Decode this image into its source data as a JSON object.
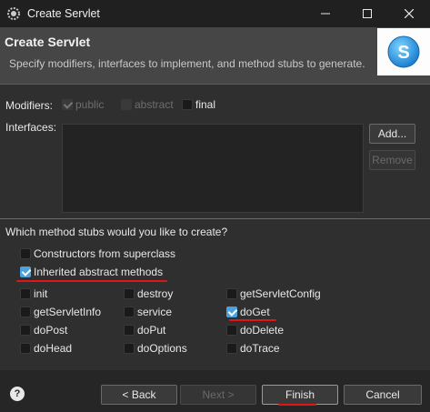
{
  "window": {
    "title": "Create Servlet",
    "minimize_icon": "minimize-icon",
    "maximize_icon": "maximize-icon",
    "close_icon": "close-icon"
  },
  "header": {
    "title": "Create Servlet",
    "description": "Specify modifiers, interfaces to implement, and method stubs to generate.",
    "logo_letter": "S"
  },
  "modifiers": {
    "label": "Modifiers:",
    "options": [
      {
        "label": "public",
        "checked": true,
        "enabled": false
      },
      {
        "label": "abstract",
        "checked": false,
        "enabled": false
      },
      {
        "label": "final",
        "checked": false,
        "enabled": true
      }
    ]
  },
  "interfaces": {
    "label": "Interfaces:",
    "add_label": "Add...",
    "remove_label": "Remove"
  },
  "method_stubs": {
    "question": "Which method stubs would you like to create?",
    "constructors": {
      "label": "Constructors from superclass",
      "checked": false
    },
    "inherited": {
      "label": "Inherited abstract methods",
      "checked": true
    },
    "methods": [
      {
        "label": "init",
        "checked": false
      },
      {
        "label": "destroy",
        "checked": false
      },
      {
        "label": "getServletConfig",
        "checked": false
      },
      {
        "label": "getServletInfo",
        "checked": false
      },
      {
        "label": "service",
        "checked": false
      },
      {
        "label": "doGet",
        "checked": true
      },
      {
        "label": "doPost",
        "checked": false
      },
      {
        "label": "doPut",
        "checked": false
      },
      {
        "label": "doDelete",
        "checked": false
      },
      {
        "label": "doHead",
        "checked": false
      },
      {
        "label": "doOptions",
        "checked": false
      },
      {
        "label": "doTrace",
        "checked": false
      }
    ]
  },
  "footer": {
    "help_label": "?",
    "back_label": "< Back",
    "next_label": "Next >",
    "finish_label": "Finish",
    "cancel_label": "Cancel"
  },
  "colors": {
    "accent": "#4aa3df",
    "highlight_line": "#e01515"
  }
}
